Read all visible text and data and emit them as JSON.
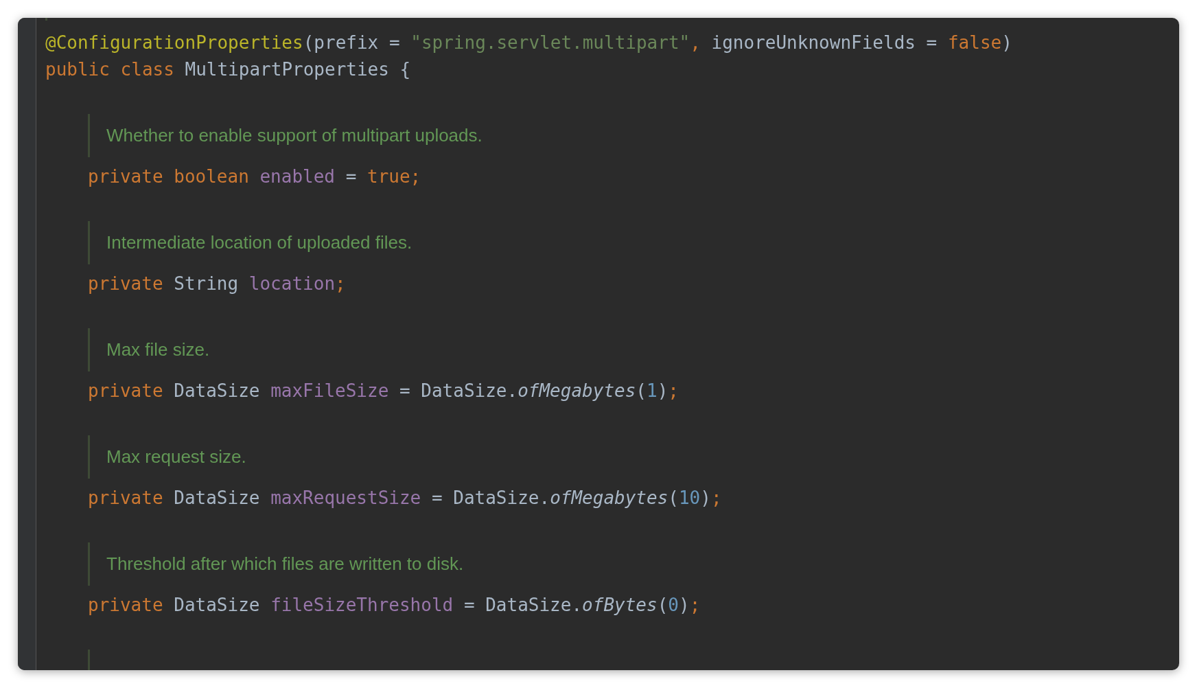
{
  "lines": [
    {
      "kind": "code",
      "tokens": [
        {
          "kind": "annotation",
          "text": "@ConfigurationProperties"
        },
        {
          "kind": "plain",
          "text": "(prefix = "
        },
        {
          "kind": "string",
          "text": "\"spring.servlet.multipart\""
        },
        {
          "kind": "keyword",
          "text": ", "
        },
        {
          "kind": "plain",
          "text": "ignoreUnknownFields = "
        },
        {
          "kind": "keyword",
          "text": "false"
        },
        {
          "kind": "plain",
          "text": ")"
        }
      ]
    },
    {
      "kind": "code",
      "tokens": [
        {
          "kind": "keyword",
          "text": "public class "
        },
        {
          "kind": "plain",
          "text": "MultipartProperties {"
        }
      ],
      "children": [
        {
          "kind": "blank"
        },
        {
          "kind": "doc",
          "text": "Whether to enable support of multipart uploads."
        },
        {
          "kind": "code",
          "tokens": [
            {
              "kind": "keyword",
              "text": "private boolean "
            },
            {
              "kind": "field",
              "text": "enabled"
            },
            {
              "kind": "plain",
              "text": " = "
            },
            {
              "kind": "keyword",
              "text": "true;"
            }
          ]
        },
        {
          "kind": "blank"
        },
        {
          "kind": "doc",
          "text": "Intermediate location of uploaded files."
        },
        {
          "kind": "code",
          "tokens": [
            {
              "kind": "keyword",
              "text": "private "
            },
            {
              "kind": "plain",
              "text": "String "
            },
            {
              "kind": "field",
              "text": "location"
            },
            {
              "kind": "keyword",
              "text": ";"
            }
          ]
        },
        {
          "kind": "blank"
        },
        {
          "kind": "doc",
          "text": "Max file size."
        },
        {
          "kind": "code",
          "tokens": [
            {
              "kind": "keyword",
              "text": "private "
            },
            {
              "kind": "plain",
              "text": "DataSize "
            },
            {
              "kind": "field",
              "text": "maxFileSize"
            },
            {
              "kind": "plain",
              "text": " = DataSize."
            },
            {
              "kind": "method",
              "text": "ofMegabytes"
            },
            {
              "kind": "plain",
              "text": "("
            },
            {
              "kind": "number",
              "text": "1"
            },
            {
              "kind": "plain",
              "text": ")"
            },
            {
              "kind": "keyword",
              "text": ";"
            }
          ]
        },
        {
          "kind": "blank"
        },
        {
          "kind": "doc",
          "text": "Max request size."
        },
        {
          "kind": "code",
          "tokens": [
            {
              "kind": "keyword",
              "text": "private "
            },
            {
              "kind": "plain",
              "text": "DataSize "
            },
            {
              "kind": "field",
              "text": "maxRequestSize"
            },
            {
              "kind": "plain",
              "text": " = DataSize."
            },
            {
              "kind": "method",
              "text": "ofMegabytes"
            },
            {
              "kind": "plain",
              "text": "("
            },
            {
              "kind": "number",
              "text": "10"
            },
            {
              "kind": "plain",
              "text": ")"
            },
            {
              "kind": "keyword",
              "text": ";"
            }
          ]
        },
        {
          "kind": "blank"
        },
        {
          "kind": "doc",
          "text": "Threshold after which files are written to disk."
        },
        {
          "kind": "code",
          "tokens": [
            {
              "kind": "keyword",
              "text": "private "
            },
            {
              "kind": "plain",
              "text": "DataSize "
            },
            {
              "kind": "field",
              "text": "fileSizeThreshold"
            },
            {
              "kind": "plain",
              "text": " = DataSize."
            },
            {
              "kind": "method",
              "text": "ofBytes"
            },
            {
              "kind": "plain",
              "text": "("
            },
            {
              "kind": "number",
              "text": "0"
            },
            {
              "kind": "plain",
              "text": ")"
            },
            {
              "kind": "keyword",
              "text": ";"
            }
          ]
        },
        {
          "kind": "blank"
        }
      ]
    }
  ]
}
